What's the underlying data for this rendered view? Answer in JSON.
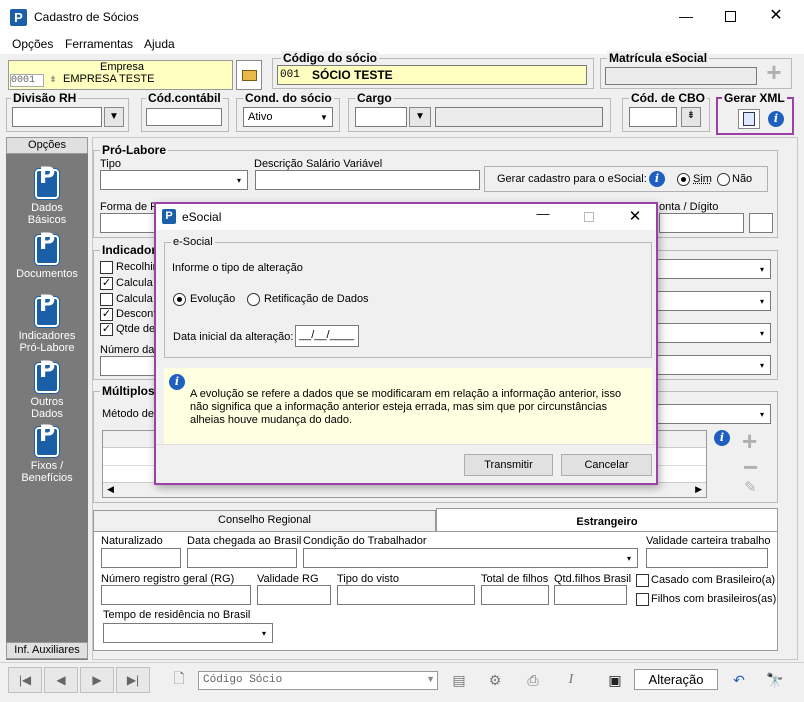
{
  "window": {
    "title": "Cadastro de Sócios"
  },
  "menu": [
    "Opções",
    "Ferramentas",
    "Ajuda"
  ],
  "empresa": {
    "label": "Empresa",
    "code": "0001",
    "name": "EMPRESA TESTE"
  },
  "codigo_socio": {
    "label": "Código do sócio",
    "code": "001",
    "name": "SÓCIO TESTE"
  },
  "matricula": {
    "label": "Matrícula eSocial"
  },
  "row2": {
    "divisao": "Divisão RH",
    "cod_contabil": "Cód.contábil",
    "cond_socio": "Cond. do sócio",
    "cond_value": "Ativo",
    "cargo": "Cargo",
    "cod_cbo": "Cód. de CBO",
    "gerar_xml": "Gerar XML"
  },
  "sidebar": {
    "header": "Opções",
    "items": [
      "Dados\nBásicos",
      "Documentos",
      "Indicadores\nPró-Labore",
      "Outros\nDados",
      "Fixos /\nBenefícios"
    ],
    "footer": "Inf. Auxiliares"
  },
  "prolabore": {
    "title": "Pró-Labore",
    "tipo": "Tipo",
    "descricao": "Descrição Salário Variável",
    "gerar_cadastro": "Gerar cadastro para o eSocial:",
    "sim": "Sim",
    "nao": "Não",
    "forma": "Forma de P",
    "conta": "onta / Dígito"
  },
  "indicadores": {
    "title": "Indicador",
    "items": [
      "Recolhim",
      "Calcula",
      "Calcula",
      "Descont",
      "Qtde de"
    ],
    "checked": [
      false,
      true,
      false,
      true,
      true
    ],
    "numero": "Número da"
  },
  "multiplos": {
    "title": "Múltiplos",
    "metodo": "Método de"
  },
  "tabs": {
    "conselho": "Conselho Regional",
    "estrangeiro": "Estrangeiro"
  },
  "estrangeiro": {
    "naturalizado": "Naturalizado",
    "data_chegada": "Data chegada ao Brasil",
    "condicao": "Condição do Trabalhador",
    "validade_carteira": "Validade carteira trabalho",
    "numero_rg": "Número registro geral (RG)",
    "validade_rg": "Validade RG",
    "tipo_visto": "Tipo do visto",
    "total_filhos": "Total de filhos",
    "qtd_filhos": "Qtd.filhos Brasil",
    "casado": "Casado com Brasileiro(a)",
    "filhos_br": "Filhos com brasileiros(as)",
    "tempo": "Tempo de residência no Brasil"
  },
  "dialog": {
    "title": "eSocial",
    "group": "e-Social",
    "prompt": "Informe o tipo de alteração",
    "opt1": "Evolução",
    "opt2": "Retificação de Dados",
    "data_label": "Data inicial da alteração:",
    "data_value": "__/__/____",
    "info": "A evolução se refere a dados que se modificaram em relação a informação anterior, isso não significa que a informação anterior esteja errada, mas sim que por circunstâncias alheias houve mudança do dado.",
    "transmitir": "Transmitir",
    "cancelar": "Cancelar"
  },
  "bottom": {
    "search_placeholder": "Código Sócio",
    "mode": "Alteração"
  },
  "colors": {
    "accent": "#9c3fa6",
    "sidebar": "#7a7a7a",
    "yellow": "#ffffc0",
    "info_bg": "#ffffe1"
  }
}
